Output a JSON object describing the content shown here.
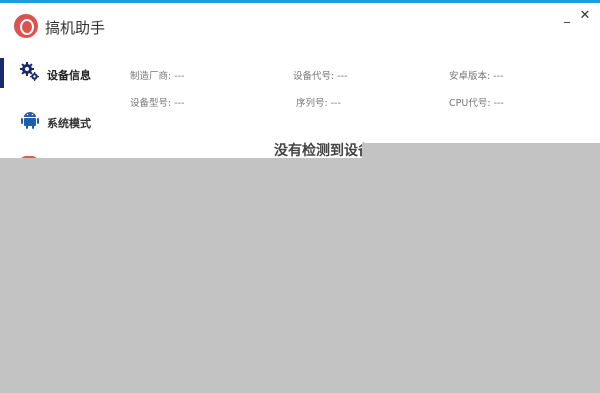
{
  "app": {
    "title": "搞机助手"
  },
  "window": {
    "minimize_label": "_",
    "close_label": "✕"
  },
  "sidebar": {
    "items": [
      {
        "label": "设备信息",
        "icon": "gears-icon",
        "active": true
      },
      {
        "label": "系统模式",
        "icon": "android-icon",
        "active": false
      }
    ]
  },
  "device_info": {
    "manufacturer": {
      "label": "制造厂商:",
      "value": "---"
    },
    "device_code": {
      "label": "设备代号:",
      "value": "---"
    },
    "android_version": {
      "label": "安卓版本:",
      "value": "---"
    },
    "model": {
      "label": "设备型号:",
      "value": "---"
    },
    "serial": {
      "label": "序列号:",
      "value": "---"
    },
    "cpu": {
      "label": "CPU代号:",
      "value": "---"
    }
  },
  "status": {
    "no_device": "没有检测到设备"
  },
  "colors": {
    "accent": "#1aa0d8",
    "active_bar": "#1b2a6b",
    "overlay": "#c3c3c3",
    "logo": "#d9534f"
  }
}
